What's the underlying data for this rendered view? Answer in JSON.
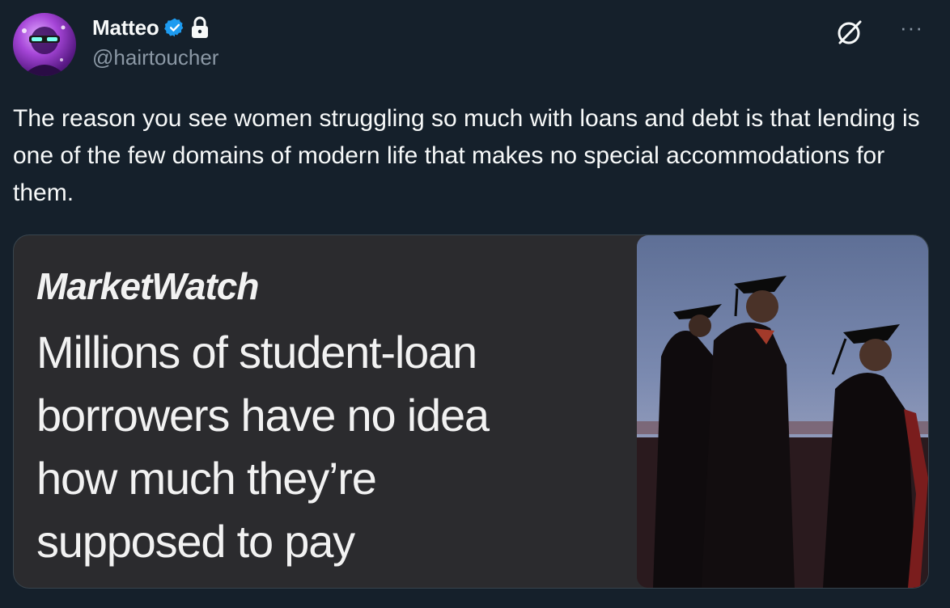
{
  "author": {
    "display_name": "Matteo",
    "handle": "@hairtoucher",
    "verified": true,
    "protected": true
  },
  "icons": {
    "verified": "verified-badge-icon",
    "lock": "lock-icon",
    "grok": "grok-icon",
    "more": "more-icon",
    "more_glyph": "···"
  },
  "tweet": {
    "text": "The reason you see women struggling so much with loans and debt is that lending is one of the few domains of modern life that makes no special accommodations for them."
  },
  "media": {
    "source_logo": "MarketWatch",
    "headline_lines": [
      "Millions of student-loan",
      "borrowers have no idea",
      "how much they’re",
      "supposed to pay"
    ]
  },
  "colors": {
    "background": "#15202b",
    "text_primary": "#f7f9f9",
    "text_secondary": "#8b98a5",
    "verified_blue": "#1d9bf0",
    "card_border": "#38444d",
    "card_background": "#2b2b2e"
  }
}
